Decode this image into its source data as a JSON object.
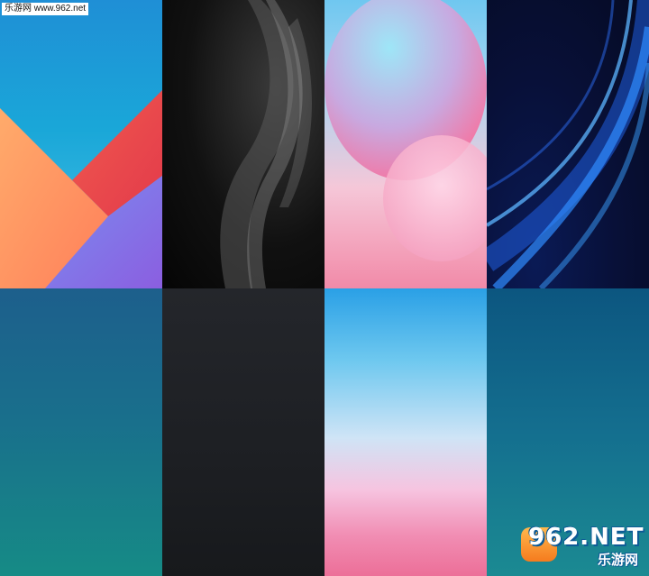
{
  "watermark": {
    "site_label": "乐游网 www.962.net",
    "logo_main": "962.NET",
    "logo_sub": "乐游网"
  },
  "wallpapers": [
    {
      "row": 1,
      "col": 1,
      "style": "material-geometric",
      "colors": [
        "#1f8fd6",
        "#ff8f5a",
        "#e9474f",
        "#8a6ae6"
      ]
    },
    {
      "row": 1,
      "col": 2,
      "style": "dark-silk",
      "colors": [
        "#050505",
        "#6b6b6b"
      ]
    },
    {
      "row": 1,
      "col": 3,
      "style": "pink-bubbles",
      "colors": [
        "#6fc7f0",
        "#f28aa8"
      ]
    },
    {
      "row": 1,
      "col": 4,
      "style": "blue-light-streaks",
      "colors": [
        "#050a22",
        "#2f7bff"
      ]
    },
    {
      "row": 2,
      "col": 1,
      "style": "teal-gradient",
      "colors": [
        "#1d5f8c",
        "#168b86"
      ]
    },
    {
      "row": 2,
      "col": 2,
      "style": "charcoal-gradient",
      "colors": [
        "#24262b",
        "#17191c"
      ]
    },
    {
      "row": 2,
      "col": 3,
      "style": "sky-pink-gradient",
      "colors": [
        "#2aa0e6",
        "#ec6f98"
      ]
    },
    {
      "row": 2,
      "col": 4,
      "style": "ocean-gradient",
      "colors": [
        "#0c5680",
        "#1b8a92"
      ]
    }
  ]
}
